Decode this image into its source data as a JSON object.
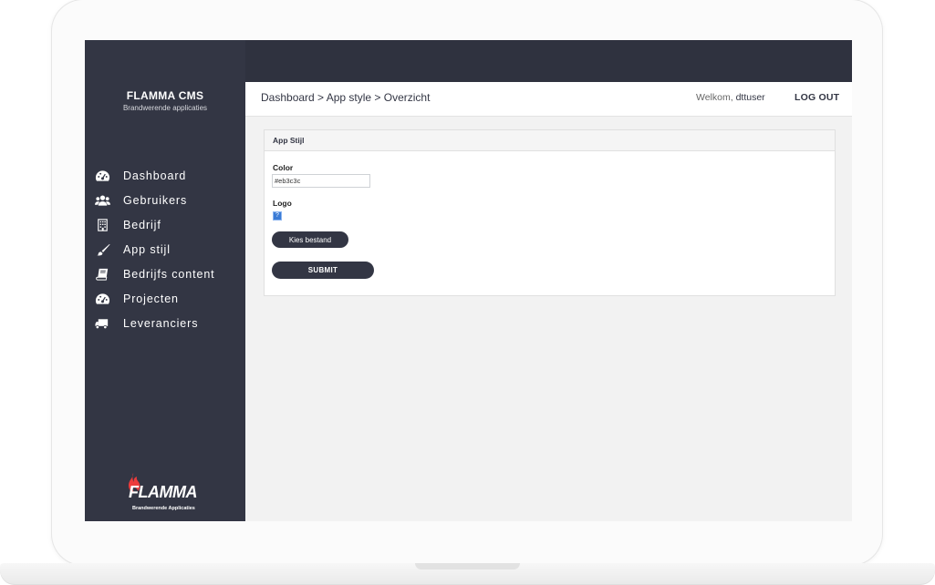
{
  "brand": {
    "title": "FLAMMA CMS",
    "subtitle": "Brandwerende applicaties"
  },
  "nav": {
    "items": [
      {
        "label": "Dashboard",
        "icon": "dashboard-gauge-icon"
      },
      {
        "label": "Gebruikers",
        "icon": "users-icon"
      },
      {
        "label": "Bedrijf",
        "icon": "building-icon"
      },
      {
        "label": "App stijl",
        "icon": "paintbrush-icon"
      },
      {
        "label": "Bedrijfs content",
        "icon": "book-icon"
      },
      {
        "label": "Projecten",
        "icon": "dashboard-gauge-icon"
      },
      {
        "label": "Leveranciers",
        "icon": "truck-icon"
      }
    ]
  },
  "header": {
    "breadcrumb": "Dashboard > App style > Overzicht",
    "welcome_prefix": "Welkom,",
    "username": "dttuser",
    "logout_label": "LOG OUT"
  },
  "panel": {
    "title": "App Stijl",
    "color_label": "Color",
    "color_value": "#eb3c3c",
    "logo_label": "Logo",
    "logo_placeholder": "?",
    "file_button_label": "Kies bestand",
    "submit_label": "SUBMIT"
  },
  "footer_logo": {
    "text": "FLAMMA",
    "subtitle": "Brandwerende Applicaties"
  },
  "colors": {
    "sidebar": "#333644",
    "accent": "#eb3c3c",
    "background": "#f2f2f2"
  }
}
